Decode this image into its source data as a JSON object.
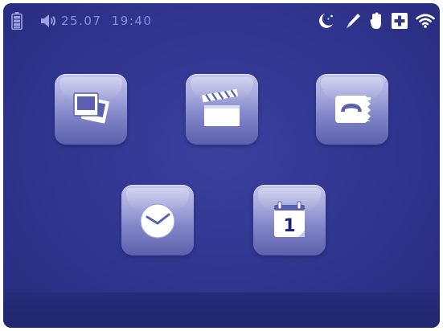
{
  "status_bar": {
    "date": "25.07",
    "time": "19:40",
    "left_icons": [
      "battery-icon",
      "speaker-icon"
    ],
    "right_icons": [
      "night-mode-icon",
      "pen-icon",
      "hand-icon",
      "plus-box-icon",
      "wifi-icon"
    ]
  },
  "menu": {
    "tiles": [
      {
        "icon": "photos-icon"
      },
      {
        "icon": "video-clapperboard-icon"
      },
      {
        "icon": "intercom-phone-icon"
      },
      {
        "icon": "clock-icon"
      },
      {
        "icon": "calendar-icon",
        "badge": "1"
      }
    ]
  },
  "colors": {
    "background": "#30358f",
    "tile": "#a6a9dc",
    "status_text": "#8b8fd6",
    "icon_white": "#ffffff"
  }
}
